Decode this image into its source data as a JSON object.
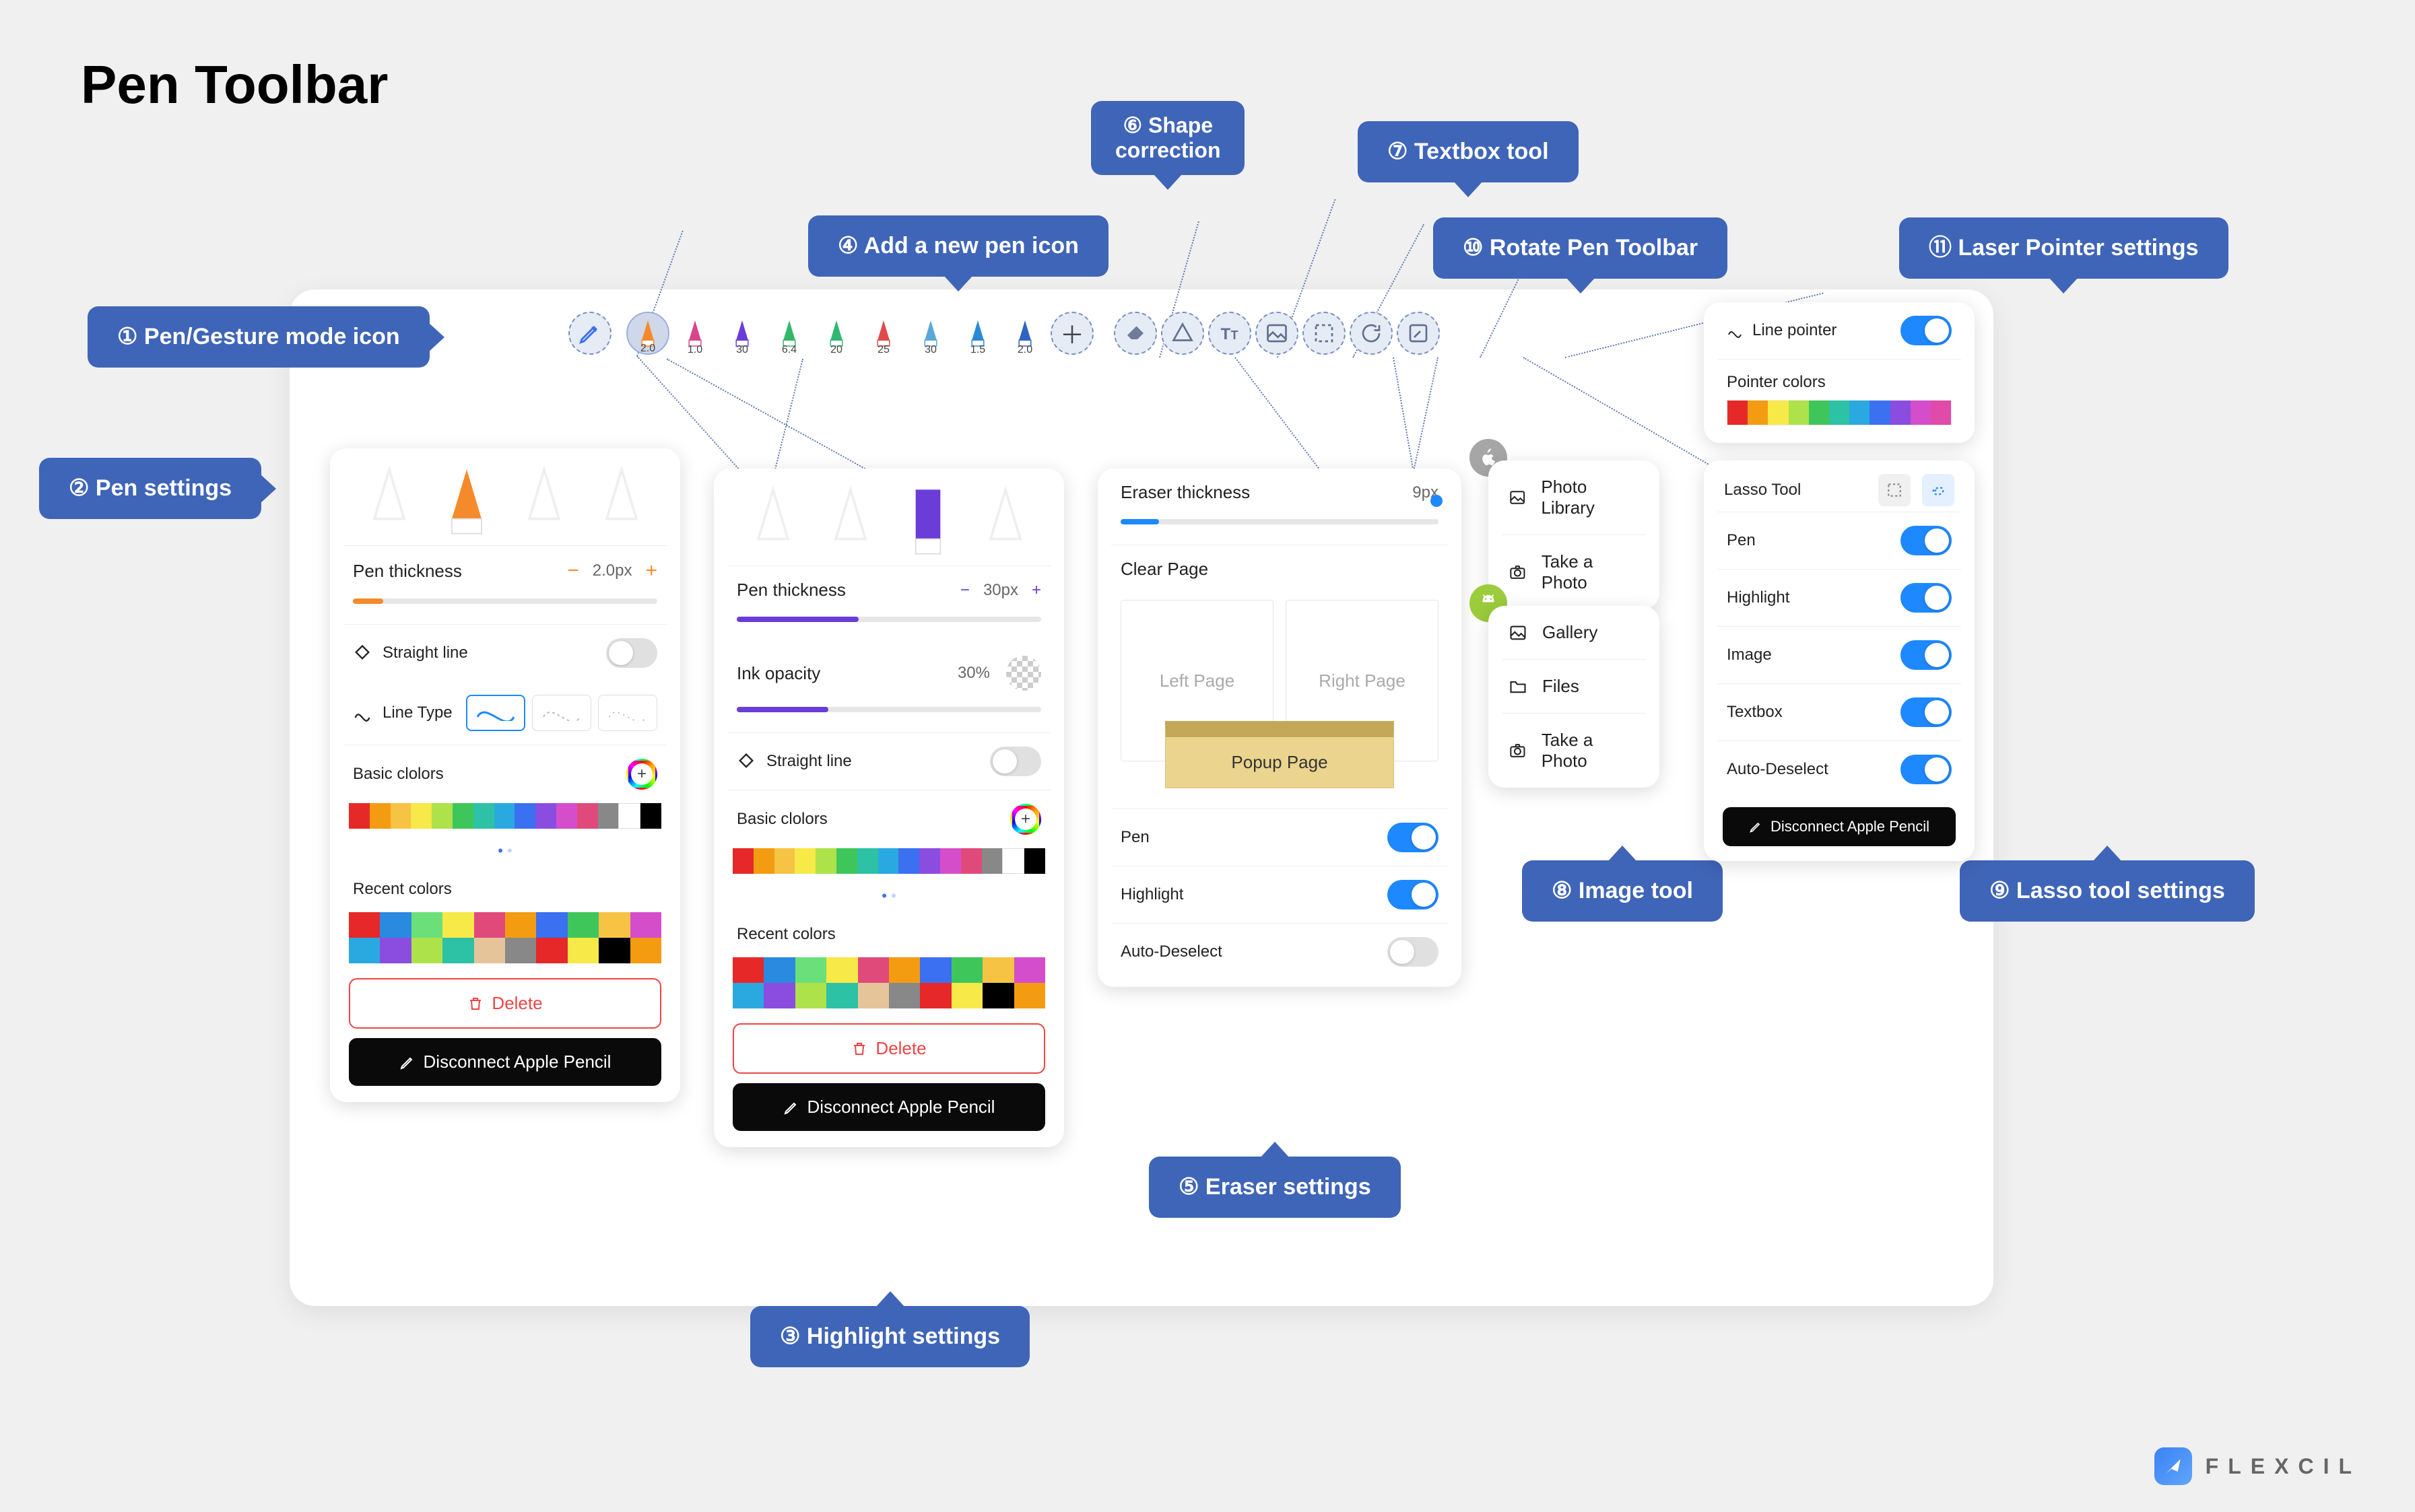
{
  "page_title": "Pen Toolbar",
  "brand": "FLEXCIL",
  "callouts": {
    "c1": "① Pen/Gesture mode icon",
    "c2": "② Pen settings",
    "c3": "③ Highlight settings",
    "c4": "④ Add a new pen icon",
    "c5": "⑤ Eraser settings",
    "c6": "⑥ Shape\ncorrection",
    "c7": "⑦ Textbox tool",
    "c8": "⑧ Image tool",
    "c9": "⑨ Lasso tool settings",
    "c10": "⑩ Rotate Pen Toolbar",
    "c11": "⑪ Laser Pointer settings"
  },
  "toolbar": {
    "pens": [
      {
        "color": "#f58a2a",
        "size": "2.0"
      },
      {
        "color": "#d9448a",
        "size": "1.0"
      },
      {
        "color": "#6a3dd9",
        "size": "30"
      },
      {
        "color": "#33b86b",
        "size": "6.4"
      },
      {
        "color": "#2fb873",
        "size": "20"
      },
      {
        "color": "#e04a4a",
        "size": "25"
      },
      {
        "color": "#5aa7d9",
        "size": "30"
      },
      {
        "color": "#2b8ad5",
        "size": "1.5"
      },
      {
        "color": "#2f64c3",
        "size": "2.0"
      }
    ]
  },
  "pen_panel": {
    "thickness_label": "Pen thickness",
    "thickness_value": "2.0px",
    "straight_line": "Straight line",
    "line_type": "Line Type",
    "basic_colors": "Basic clolors",
    "recent_colors": "Recent colors",
    "delete": "Delete",
    "disconnect": "Disconnect Apple Pencil"
  },
  "highlight_panel": {
    "thickness_label": "Pen thickness",
    "thickness_value": "30px",
    "opacity_label": "Ink opacity",
    "opacity_value": "30%",
    "straight_line": "Straight line",
    "basic_colors": "Basic clolors",
    "recent_colors": "Recent colors",
    "delete": "Delete",
    "disconnect": "Disconnect Apple Pencil"
  },
  "eraser_panel": {
    "thickness_label": "Eraser thickness",
    "thickness_value": "9px",
    "clear_page": "Clear Page",
    "left_page": "Left Page",
    "right_page": "Right Page",
    "popup_page": "Popup Page",
    "pen": "Pen",
    "highlight": "Highlight",
    "auto_deselect": "Auto-Deselect"
  },
  "image_panel": {
    "ios": {
      "photo_library": "Photo Library",
      "take_photo": "Take a Photo"
    },
    "android": {
      "gallery": "Gallery",
      "files": "Files",
      "take_photo": "Take a Photo"
    }
  },
  "laser_panel": {
    "line_pointer": "Line pointer",
    "pointer_colors": "Pointer colors"
  },
  "lasso_panel": {
    "title": "Lasso Tool",
    "pen": "Pen",
    "highlight": "Highlight",
    "image": "Image",
    "textbox": "Textbox",
    "auto_deselect": "Auto-Deselect",
    "disconnect": "Disconnect Apple Pencil"
  },
  "colors": {
    "basic": [
      "#e62828",
      "#f39c12",
      "#f6c344",
      "#f7e948",
      "#aee24a",
      "#3fc65a",
      "#2dc1a5",
      "#2aa9e0",
      "#3b70f0",
      "#8a4de0",
      "#d44ecb",
      "#e04a7a",
      "#888888",
      "#ffffff",
      "#000000"
    ],
    "recent": [
      "#e62828",
      "#2a8adf",
      "#6be07a",
      "#f7e948",
      "#e04a7a",
      "#f39c12",
      "#3b70f0",
      "#3fc65a",
      "#f6c344",
      "#d44ecb",
      "#2aa9e0",
      "#8a4de0",
      "#aee24a",
      "#2dc1a5",
      "#e6c49a",
      "#888888",
      "#e62828",
      "#f7e948",
      "#000000",
      "#f39c12"
    ],
    "pointer": [
      "#e62828",
      "#f39c12",
      "#f7e948",
      "#aee24a",
      "#3fc65a",
      "#2dc1a5",
      "#2aa9e0",
      "#3b70f0",
      "#8a4de0",
      "#d44ecb",
      "#e04aa8"
    ]
  }
}
